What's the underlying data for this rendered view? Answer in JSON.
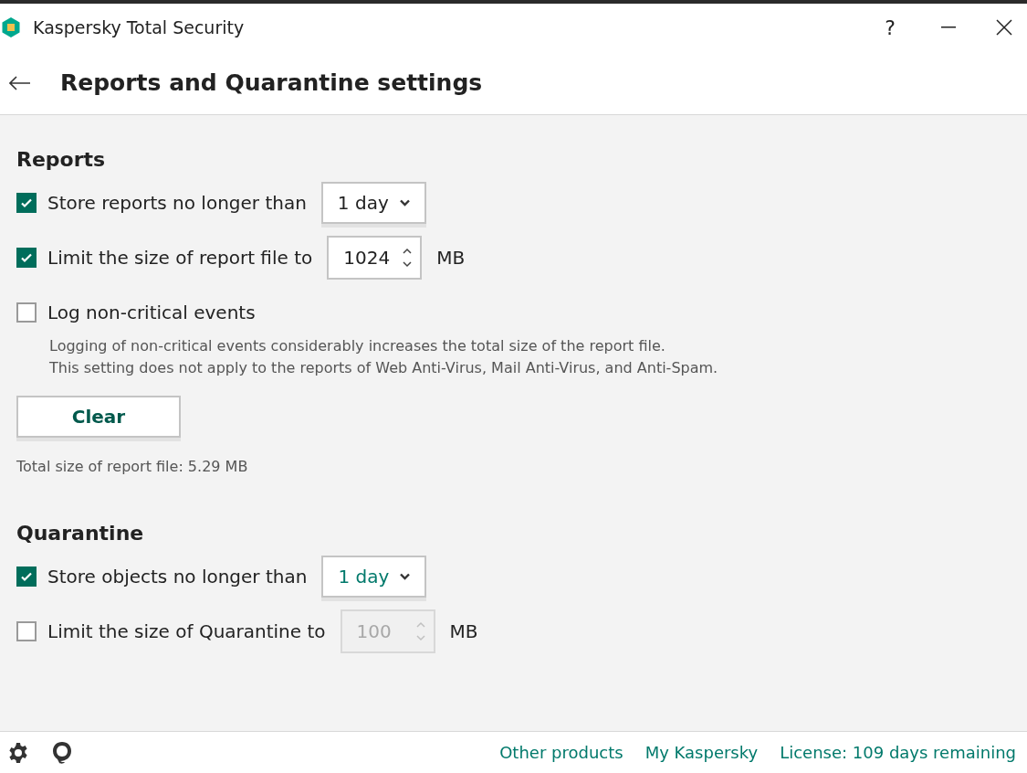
{
  "window": {
    "title": "Kaspersky Total Security",
    "help": "?"
  },
  "header": {
    "title": "Reports and Quarantine settings"
  },
  "sections": [
    {
      "title": "Reports",
      "rows": [
        {
          "kind": "select",
          "label": "Store reports no longer than",
          "checked": true,
          "value": "1 day",
          "highlighted": false
        },
        {
          "kind": "spin",
          "label": "Limit the size of report file to",
          "checked": true,
          "value": "1024",
          "unit": "MB",
          "disabled": false
        },
        {
          "kind": "plain",
          "label": "Log non-critical events",
          "checked": false,
          "description": [
            "Logging of non-critical events considerably increases the total size of the report file.",
            "This setting does not apply to the reports of Web Anti-Virus, Mail Anti-Virus, and Anti-Spam."
          ]
        }
      ],
      "button": "Clear",
      "note": "Total size of report file: 5.29 MB"
    },
    {
      "title": "Quarantine",
      "rows": [
        {
          "kind": "select",
          "label": "Store objects no longer than",
          "checked": true,
          "value": "1 day",
          "highlighted": true
        },
        {
          "kind": "spin",
          "label": "Limit the size of Quarantine to",
          "checked": false,
          "value": "100",
          "unit": "MB",
          "disabled": true
        }
      ]
    }
  ],
  "footer": {
    "links": [
      "Other products",
      "My Kaspersky",
      "License: 109 days remaining"
    ]
  }
}
